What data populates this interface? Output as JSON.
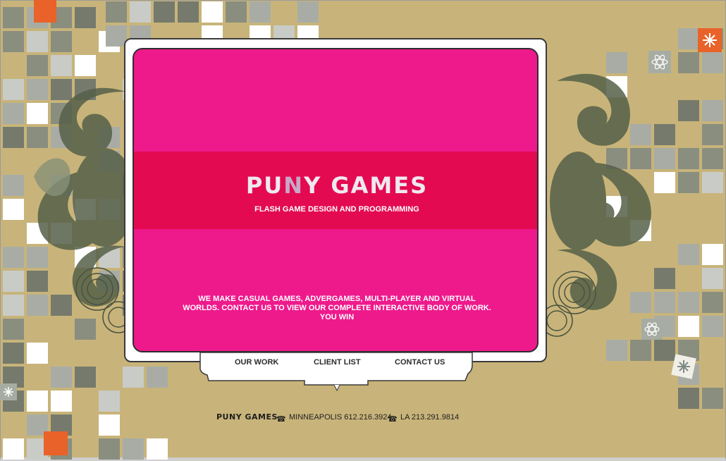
{
  "brand": {
    "logo_part1": "PU",
    "logo_part2": "N",
    "logo_part3": "Y GAMES",
    "tagline": "FLASH GAME DESIGN AND PROGRAMMING"
  },
  "intro": {
    "line1": "WE MAKE CASUAL GAMES, ADVERGAMES, MULTI-PLAYER AND VIRTUAL",
    "line2": "WORLDS.  CONTACT US TO VIEW OUR COMPLETE INTERACTIVE BODY OF WORK.",
    "line3": "YOU WIN"
  },
  "nav": {
    "our_work": "OUR WORK",
    "client_list": "CLIENT LIST",
    "contact_us": "CONTACT US"
  },
  "footer": {
    "logo": "PUNY GAMES",
    "minneapolis": "MINNEAPOLIS 612.216.3924",
    "la": "LA 213.291.9814",
    "phone_icon": "phone-icon"
  },
  "colors": {
    "background": "#c8b47a",
    "panel_pink": "#ee1a8c",
    "band_red": "#e30a52",
    "accent_orange": "#e8622a"
  }
}
